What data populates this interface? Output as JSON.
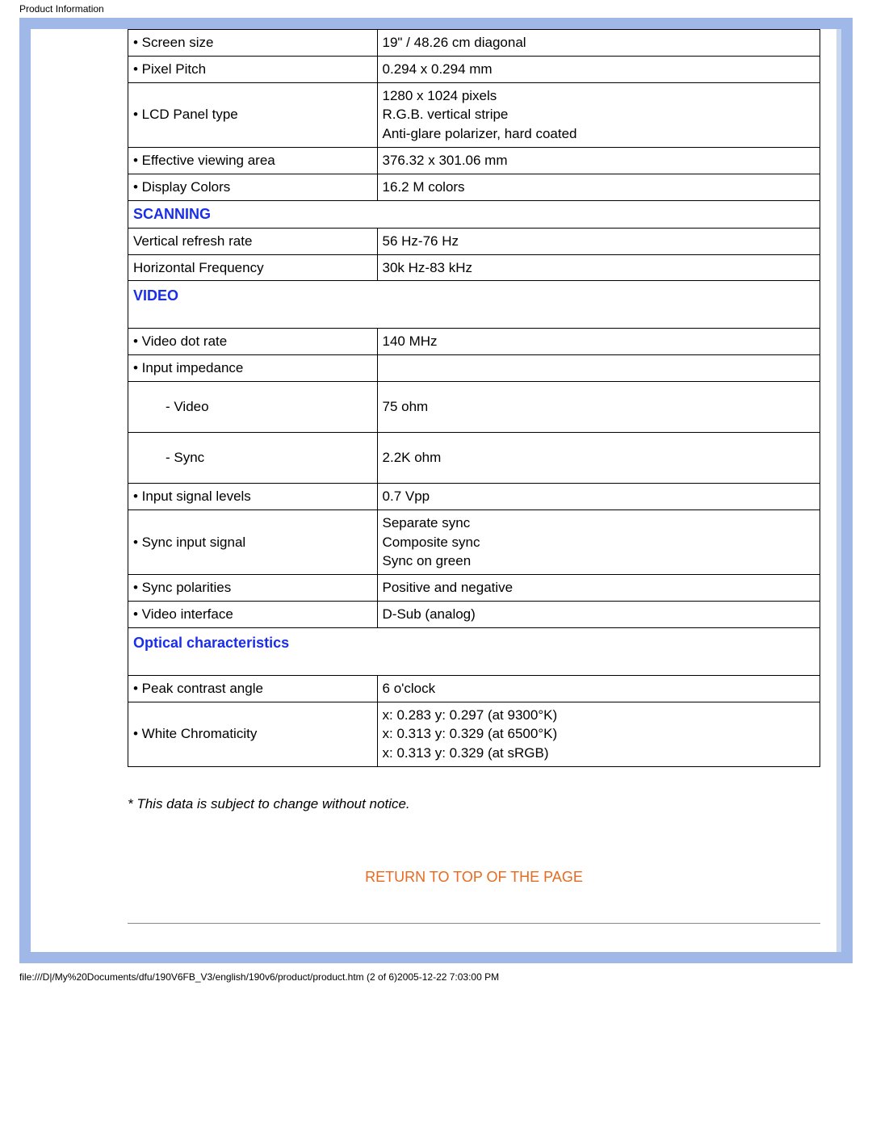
{
  "page": {
    "header_title": "Product Information",
    "footer_path": "file:///D|/My%20Documents/dfu/190V6FB_V3/english/190v6/product/product.htm (2 of 6)2005-12-22 7:03:00 PM"
  },
  "sections": {
    "display_rows": [
      {
        "label": "• Screen size",
        "value": "19\" / 48.26 cm diagonal"
      },
      {
        "label": "• Pixel Pitch",
        "value": "0.294 x 0.294 mm"
      },
      {
        "label": "• LCD Panel type",
        "value": "1280 x 1024 pixels\nR.G.B. vertical stripe\nAnti-glare polarizer, hard coated"
      },
      {
        "label": "• Effective viewing area",
        "value": "376.32 x 301.06 mm"
      },
      {
        "label": "• Display Colors",
        "value": "16.2 M colors"
      }
    ],
    "scanning_header": "SCANNING",
    "scanning_rows": [
      {
        "label": "Vertical refresh rate",
        "value": "56 Hz-76 Hz"
      },
      {
        "label": "Horizontal Frequency",
        "value": "30k Hz-83 kHz"
      }
    ],
    "video_header": "VIDEO",
    "video_rows": [
      {
        "label": "• Video dot rate",
        "value": "140 MHz"
      },
      {
        "label": "• Input impedance",
        "value": ""
      },
      {
        "label": "- Video",
        "value": "75 ohm",
        "indent": true,
        "tall": true
      },
      {
        "label": "- Sync",
        "value": "2.2K ohm",
        "indent": true,
        "tall": true
      },
      {
        "label": "• Input signal levels",
        "value": "0.7 Vpp"
      },
      {
        "label": "• Sync input signal",
        "value": "Separate sync\nComposite sync\nSync on green"
      },
      {
        "label": "• Sync polarities",
        "value": "Positive and negative"
      },
      {
        "label": "• Video interface",
        "value": "D-Sub (analog)"
      }
    ],
    "optical_header": "Optical characteristics",
    "optical_rows": [
      {
        "label": "• Peak contrast angle",
        "value": "6 o'clock"
      },
      {
        "label": "• White Chromaticity",
        "value": "x: 0.283 y: 0.297 (at 9300°K)\nx: 0.313 y: 0.329 (at 6500°K)\nx: 0.313 y: 0.329 (at sRGB)",
        "med": true
      }
    ]
  },
  "footnote": "* This data is subject to change without notice.",
  "return_link": "RETURN TO TOP OF THE PAGE"
}
